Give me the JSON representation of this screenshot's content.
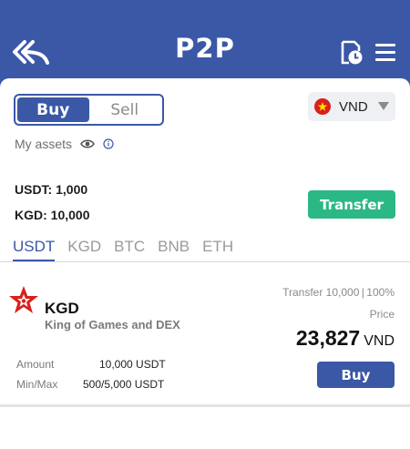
{
  "header": {
    "title": "P2P",
    "back_icon": "double-reply-arrow-icon",
    "history_icon": "document-clock-icon",
    "menu_icon": "hamburger-menu-icon"
  },
  "trade_toggle": {
    "buy_label": "Buy",
    "sell_label": "Sell",
    "selected": "Buy"
  },
  "currency_select": {
    "value": "VND",
    "flag_icon": "vietnam-flag-icon"
  },
  "assets": {
    "label": "My assets",
    "balances": [
      {
        "text": "USDT: 1,000"
      },
      {
        "text": "KGD: 10,000"
      }
    ],
    "transfer_label": "Transfer"
  },
  "tabs": [
    {
      "label": "USDT",
      "active": true
    },
    {
      "label": "KGD",
      "active": false
    },
    {
      "label": "BTC",
      "active": false
    },
    {
      "label": "BNB",
      "active": false
    },
    {
      "label": "ETH",
      "active": false
    }
  ],
  "offer": {
    "token": "KGD",
    "description": "King of Games and DEX",
    "meta": "Transfer 10,000 | 100%",
    "price_label": "Price",
    "price": "23,827",
    "price_currency": "VND",
    "amount_label": "Amount",
    "amount_value": "10,000 USDT",
    "minmax_label": "Min/Max",
    "minmax_value": "500/5,000 USDT",
    "buy_label": "Buy"
  },
  "colors": {
    "primary": "#3b58a6",
    "transfer_green": "#2bb884",
    "logo_red": "#d8201a"
  }
}
